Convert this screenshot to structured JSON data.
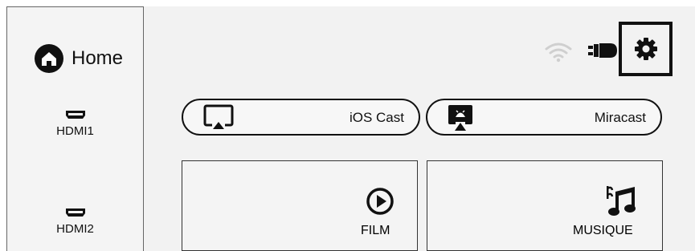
{
  "sidebar": {
    "home_label": "Home",
    "items": [
      {
        "label": "HDMI1",
        "icon": "hdmi-port-icon"
      },
      {
        "label": "HDMI2",
        "icon": "hdmi-port-icon"
      }
    ]
  },
  "status_bar": {
    "icons": [
      "wifi-icon",
      "power-plug-icon",
      "settings-gear-icon"
    ]
  },
  "cast_buttons": [
    {
      "label": "iOS Cast",
      "icon": "airplay-icon"
    },
    {
      "label": "Miracast",
      "icon": "android-cast-icon"
    }
  ],
  "tiles": [
    {
      "label": "FILM",
      "icon": "play-circle-icon"
    },
    {
      "label": "MUSIQUE",
      "icon": "music-notes-icon"
    }
  ],
  "colors": {
    "background": "#f2f2f2",
    "foreground": "#111111",
    "wifi": "#cfcfcf"
  }
}
